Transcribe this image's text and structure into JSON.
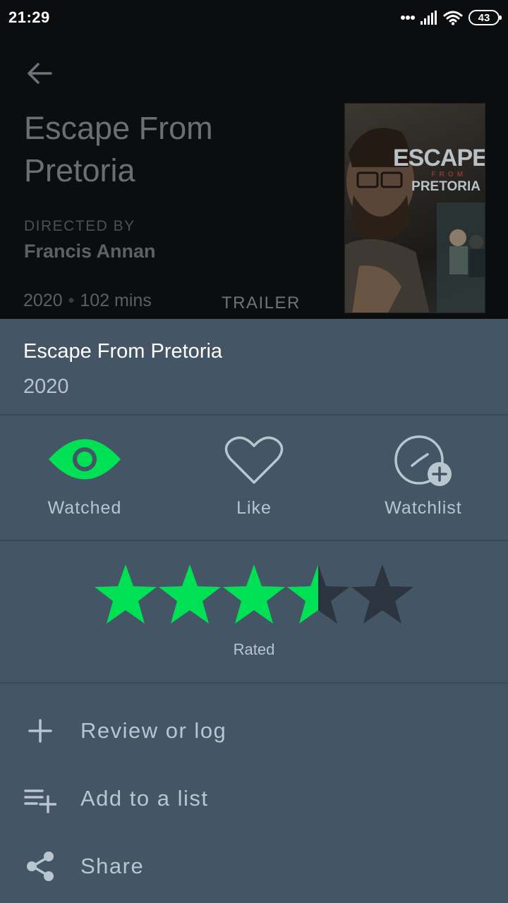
{
  "status_bar": {
    "time": "21:29",
    "battery": "43"
  },
  "film": {
    "title": "Escape From Pretoria",
    "directed_by_label": "DIRECTED BY",
    "director": "Francis Annan",
    "year": "2020",
    "runtime": "102 mins",
    "trailer_label": "TRAILER",
    "poster": {
      "line1": "ESCAPE",
      "line2": "FROM",
      "line3": "PRETORIA"
    }
  },
  "sheet": {
    "title": "Escape From Pretoria",
    "year": "2020",
    "actions": [
      {
        "label": "Watched",
        "icon": "eye-icon",
        "active": true
      },
      {
        "label": "Like",
        "icon": "heart-icon",
        "active": false
      },
      {
        "label": "Watchlist",
        "icon": "clock-plus-icon",
        "active": false
      }
    ],
    "rating": {
      "value": 3.5,
      "max": 5,
      "label": "Rated"
    },
    "menu": [
      {
        "label": "Review or log",
        "icon": "plus-icon"
      },
      {
        "label": "Add to a list",
        "icon": "playlist-add-icon"
      },
      {
        "label": "Share",
        "icon": "share-icon"
      }
    ]
  },
  "colors": {
    "accent_green": "#00e054",
    "sheet_bg": "#445566",
    "empty_star": "#2c3440",
    "header_bg": "#0c0d0e"
  }
}
